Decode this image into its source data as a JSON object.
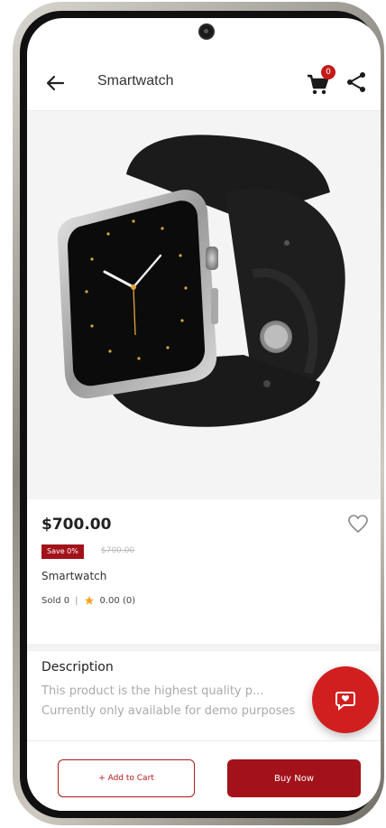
{
  "header": {
    "title": "Smartwatch",
    "cart_count": "0"
  },
  "product": {
    "price": "$700.00",
    "save_badge": "Save 0%",
    "old_price": "$700.00",
    "name": "Smartwatch",
    "sold": "Sold 0",
    "separator": "|",
    "rating": "0.00 (0)"
  },
  "description": {
    "title": "Description",
    "line1": "This product is the highest quality p...",
    "line2": "Currently only available for demo purposes"
  },
  "actions": {
    "add_to_cart": "+ Add to Cart",
    "buy_now": "Buy Now"
  },
  "colors": {
    "accent": "#a3121a",
    "fab": "#d11f1f",
    "badge": "#c41a1a",
    "star": "#f5a623"
  },
  "icons": [
    "back-arrow-icon",
    "cart-icon",
    "share-icon",
    "heart-icon",
    "star-icon",
    "chat-icon"
  ]
}
